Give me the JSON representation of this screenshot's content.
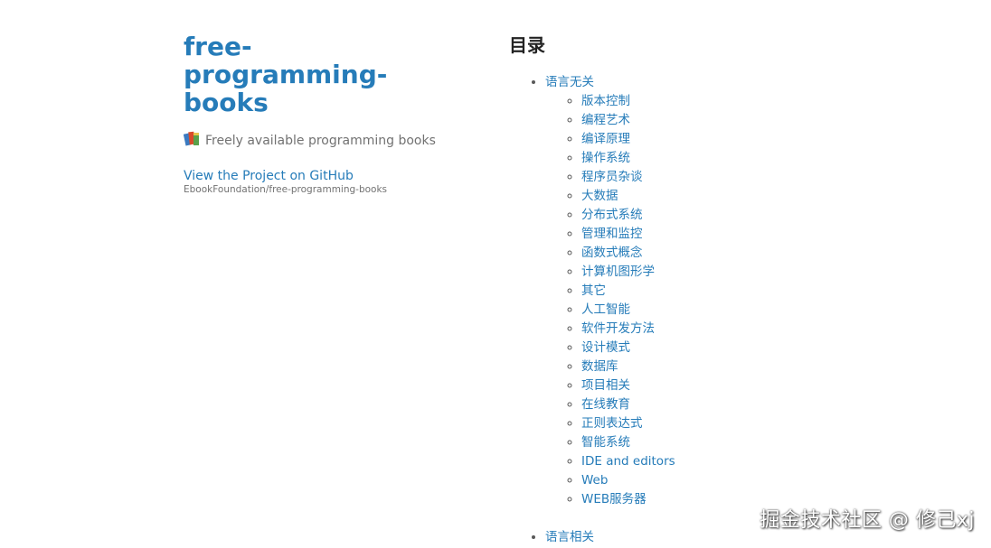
{
  "header": {
    "title": "free-programming-books",
    "tagline": "Freely available programming books",
    "github_link_label": "View the Project on GitHub",
    "github_repo": "EbookFoundation/free-programming-books"
  },
  "main": {
    "heading": "目录",
    "toc": [
      {
        "label": "语言无关",
        "children": [
          "版本控制",
          "编程艺术",
          "编译原理",
          "操作系统",
          "程序员杂谈",
          "大数据",
          "分布式系统",
          "管理和监控",
          "函数式概念",
          "计算机图形学",
          "其它",
          "人工智能",
          "软件开发方法",
          "设计模式",
          "数据库",
          "项目相关",
          "在线教育",
          "正则表达式",
          "智能系统",
          "IDE and editors",
          "Web",
          "WEB服务器"
        ]
      },
      {
        "label": "语言相关"
      }
    ]
  },
  "watermark": "掘金技术社区 @ 修己xj",
  "colors": {
    "link": "#267cb9",
    "text": "#595959",
    "heading": "#222222"
  }
}
